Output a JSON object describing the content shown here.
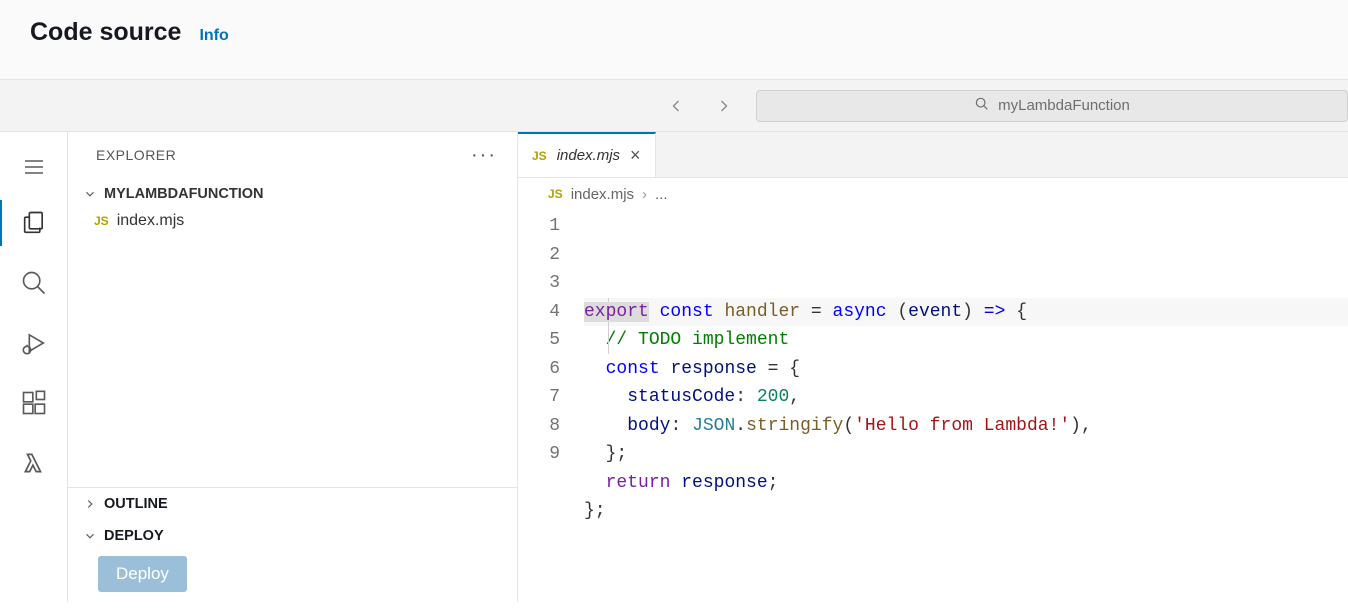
{
  "header": {
    "title": "Code source",
    "info_label": "Info"
  },
  "toolbar": {
    "search_placeholder": "myLambdaFunction"
  },
  "sidebar": {
    "title": "EXPLORER",
    "project_name": "MYLAMBDAFUNCTION",
    "files": [
      {
        "name": "index.mjs",
        "badge": "JS"
      }
    ],
    "sections": {
      "outline": "OUTLINE",
      "deploy": "DEPLOY"
    },
    "deploy_button": "Deploy"
  },
  "editor": {
    "tab": {
      "filename": "index.mjs",
      "badge": "JS"
    },
    "breadcrumb": {
      "filename": "index.mjs",
      "badge": "JS",
      "rest": "..."
    },
    "code_lines": [
      {
        "n": 1,
        "tokens": [
          [
            "kw-export",
            "export"
          ],
          [
            "punct",
            " "
          ],
          [
            "kw-blue",
            "const"
          ],
          [
            "punct",
            " "
          ],
          [
            "func",
            "handler"
          ],
          [
            "punct",
            " "
          ],
          [
            "punct",
            "="
          ],
          [
            "punct",
            " "
          ],
          [
            "kw-blue",
            "async"
          ],
          [
            "punct",
            " "
          ],
          [
            "punct",
            "("
          ],
          [
            "ident",
            "event"
          ],
          [
            "punct",
            ")"
          ],
          [
            "punct",
            " "
          ],
          [
            "kw-blue",
            "=>"
          ],
          [
            "punct",
            " "
          ],
          [
            "punct",
            "{"
          ]
        ]
      },
      {
        "n": 2,
        "tokens": [
          [
            "punct",
            "  "
          ],
          [
            "comment",
            "// TODO implement"
          ]
        ]
      },
      {
        "n": 3,
        "tokens": [
          [
            "punct",
            "  "
          ],
          [
            "kw-blue",
            "const"
          ],
          [
            "punct",
            " "
          ],
          [
            "ident",
            "response"
          ],
          [
            "punct",
            " "
          ],
          [
            "punct",
            "="
          ],
          [
            "punct",
            " "
          ],
          [
            "punct",
            "{"
          ]
        ]
      },
      {
        "n": 4,
        "tokens": [
          [
            "punct",
            "    "
          ],
          [
            "prop",
            "statusCode"
          ],
          [
            "punct",
            ":"
          ],
          [
            "punct",
            " "
          ],
          [
            "num",
            "200"
          ],
          [
            "punct",
            ","
          ]
        ]
      },
      {
        "n": 5,
        "tokens": [
          [
            "punct",
            "    "
          ],
          [
            "prop",
            "body"
          ],
          [
            "punct",
            ":"
          ],
          [
            "punct",
            " "
          ],
          [
            "teal",
            "JSON"
          ],
          [
            "punct",
            "."
          ],
          [
            "func",
            "stringify"
          ],
          [
            "punct",
            "("
          ],
          [
            "str",
            "'Hello from Lambda!'"
          ],
          [
            "punct",
            ")"
          ],
          [
            "punct",
            ","
          ]
        ]
      },
      {
        "n": 6,
        "tokens": [
          [
            "punct",
            "  "
          ],
          [
            "punct",
            "};"
          ]
        ]
      },
      {
        "n": 7,
        "tokens": [
          [
            "punct",
            "  "
          ],
          [
            "kw-ctrl",
            "return"
          ],
          [
            "punct",
            " "
          ],
          [
            "ident",
            "response"
          ],
          [
            "punct",
            ";"
          ]
        ]
      },
      {
        "n": 8,
        "tokens": [
          [
            "punct",
            "};"
          ]
        ]
      },
      {
        "n": 9,
        "tokens": []
      }
    ]
  }
}
